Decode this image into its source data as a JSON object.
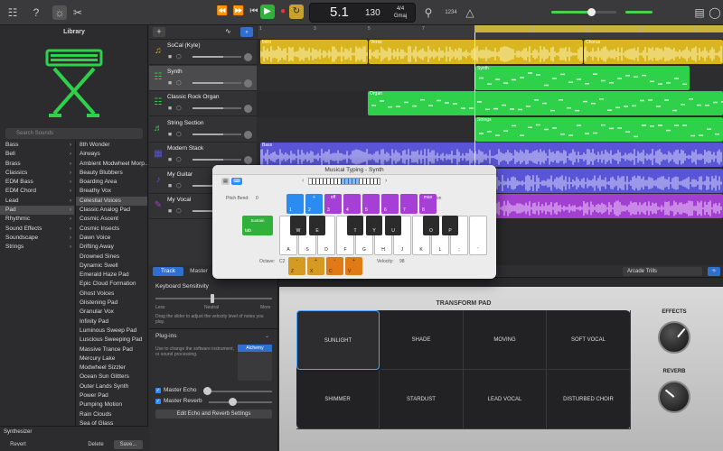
{
  "toolbar": {
    "lcd": {
      "beat": "5.1",
      "tempo": "130",
      "signature_top": "4/4",
      "signature_bottom": "Gmaj",
      "bar_label": "BAR",
      "beat_label": "BEAT",
      "tempo_label": "TEMPO"
    },
    "count_in": "1234"
  },
  "library": {
    "title": "Library",
    "search_placeholder": "Search Sounds",
    "categories": [
      "Bass",
      "Bell",
      "Brass",
      "Classics",
      "EDM Bass",
      "EDM Chord",
      "Lead",
      "Pad",
      "Rhythmic",
      "Sound Effects",
      "Soundscape",
      "Strings"
    ],
    "patches": [
      "8th Wonder",
      "Airways",
      "Ambient Modwheel Morp...",
      "Beauty Blubbers",
      "Boarding Area",
      "Breathy Vox",
      "Celestial Voices",
      "Classic Analog Pad",
      "Cosmic Ascent",
      "Cosmic Insects",
      "Dawn Voice",
      "Drifting Away",
      "Drowned Sines",
      "Dynamic Swell",
      "Emerald Haze Pad",
      "Epic Cloud Formation",
      "Ghost Voices",
      "Glistening Pad",
      "Granular Vox",
      "Infinity Pad",
      "Luminous Sweep Pad",
      "Luscious Sweeping Pad",
      "Massive Trance Pad",
      "Mercury Lake",
      "Modwheel Sizzler",
      "Ocean Sun Glitters",
      "Outer Lands Synth",
      "Power Pad",
      "Pumping Motion",
      "Rain Clouds",
      "Sea of Glass"
    ],
    "preset_name": "Synthesizer",
    "revert": "Revert",
    "delete": "Delete",
    "save": "Save..."
  },
  "tracks": [
    {
      "name": "SoCal (Kyle)",
      "icon": "drummer-icon",
      "color": "#d9b520"
    },
    {
      "name": "Synth",
      "icon": "synth-icon",
      "color": "#2fd04a"
    },
    {
      "name": "Classic Rock Organ",
      "icon": "organ-icon",
      "color": "#2fd04a"
    },
    {
      "name": "String Section",
      "icon": "strings-icon",
      "color": "#2fd04a"
    },
    {
      "name": "Modern Stack",
      "icon": "amp-icon",
      "color": "#5a55d6"
    },
    {
      "name": "My Guitar",
      "icon": "guitar-icon",
      "color": "#5a55d6"
    },
    {
      "name": "My Vocal",
      "icon": "mic-icon",
      "color": "#a23fd0"
    }
  ],
  "ruler_numbers": [
    "1",
    "3",
    "5",
    "7",
    "9",
    "11",
    "13",
    "15",
    "17"
  ],
  "regions": {
    "intro": "Intro",
    "verse": "Verse",
    "chorus": "Chorus",
    "synth": "Synth",
    "organ": "Organ",
    "strings": "Strings",
    "bass": "Bass",
    "guitar": "My Guitar",
    "vocal": "My Vocal"
  },
  "inspector": {
    "tab_track": "Track",
    "tab_master": "Master",
    "keyboard_sensitivity": "Keyboard Sensitivity",
    "less": "Less",
    "neutral": "Neutral",
    "more": "More",
    "sens_help": "Drag the slider to adjust the velocity level of notes you play.",
    "plugins": "Plug-ins",
    "plugins_help": "Use to change the software instrument, or sound processing.",
    "alchemy": "Alchemy",
    "master_echo": "Master Echo",
    "master_reverb": "Master Reverb",
    "edit_button": "Edit Echo and Reverb Settings"
  },
  "smart": {
    "preset": "Arcade Trills",
    "transform_pad_title": "TRANSFORM PAD",
    "pad_cells": [
      "SUNLIGHT",
      "SHADE",
      "MOVING",
      "SOFT VOCAL",
      "SHIMMER",
      "STARDUST",
      "LEAD VOCAL",
      "DISTURBED CHOIR"
    ],
    "effects_label": "EFFECTS",
    "reverb_label": "REVERB"
  },
  "musical_typing": {
    "title": "Musical Typing - Synth",
    "pitch_bend": "Pitch Bend:",
    "modulation": "Modulation",
    "sustain": "Sustain",
    "sustain_key": "tab",
    "octave_label": "Octave:",
    "octave_value": "C2",
    "velocity_label": "Velocity:",
    "velocity_value": "98",
    "top_row": [
      {
        "top": "",
        "bottom": "1",
        "color": "#2a8cf0"
      },
      {
        "top": "+",
        "bottom": "2",
        "color": "#2a8cf0"
      },
      {
        "top": "off",
        "bottom": "3",
        "color": "#a53fd6"
      },
      {
        "top": "",
        "bottom": "4",
        "color": "#a53fd6"
      },
      {
        "top": "",
        "bottom": "5",
        "color": "#a53fd6"
      },
      {
        "top": "",
        "bottom": "6",
        "color": "#a53fd6"
      },
      {
        "top": "",
        "bottom": "7",
        "color": "#a53fd6"
      },
      {
        "top": "max",
        "bottom": "8",
        "color": "#a53fd6"
      }
    ],
    "pitch_zero": "0",
    "white_keys": [
      "A",
      "S",
      "D",
      "F",
      "G",
      "H",
      "J",
      "K",
      "L",
      ";",
      "'"
    ],
    "black_keys": [
      "W",
      "E",
      "T",
      "Y",
      "U",
      "O",
      "P"
    ],
    "octave_keys": [
      {
        "top": "-",
        "bottom": "Z"
      },
      {
        "top": "+",
        "bottom": "X"
      }
    ],
    "velocity_keys": [
      {
        "top": "-",
        "bottom": "C"
      },
      {
        "top": "+",
        "bottom": "V"
      }
    ]
  }
}
